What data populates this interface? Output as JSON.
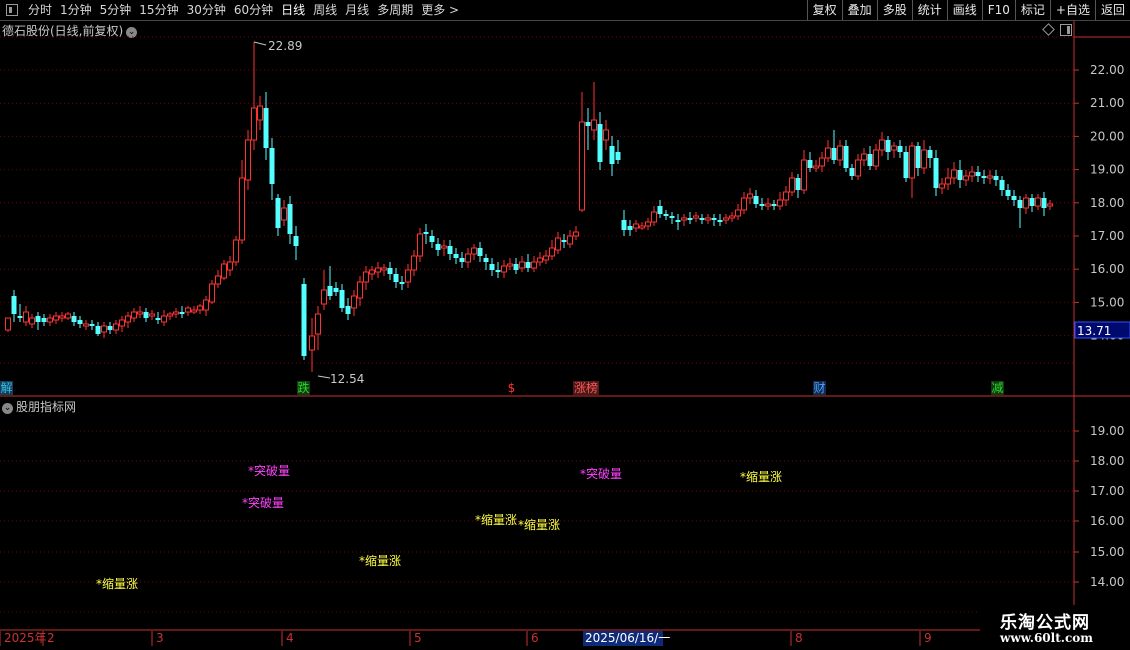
{
  "toolbar": {
    "periods": [
      "分时",
      "1分钟",
      "5分钟",
      "15分钟",
      "30分钟",
      "60分钟",
      "日线",
      "周线",
      "月线",
      "多周期",
      "更多 >"
    ],
    "active_period": "日线",
    "actions": [
      "复权",
      "叠加",
      "多股",
      "统计",
      "画线",
      "F10",
      "标记",
      "+自选",
      "返回"
    ]
  },
  "main_title": "德石股份(日线,前复权)",
  "sub_title": "股朋指标网",
  "price_axis": [
    "22.00",
    "21.00",
    "20.00",
    "19.00",
    "18.00",
    "17.00",
    "16.00",
    "15.00",
    "14.00"
  ],
  "current_price": "13.71",
  "high_label": "22.89",
  "low_label": "12.54",
  "event_tags": [
    {
      "text": "解",
      "color": "#2ec2e8",
      "bg": "#1a3a5a"
    },
    {
      "text": "跌",
      "color": "#22dd22",
      "bg": "#143a14"
    },
    {
      "text": "$",
      "color": "#ff3030",
      "bg": "#000"
    },
    {
      "text": "涨榜",
      "color": "#ff5555",
      "bg": "#4a1a1a"
    },
    {
      "text": "财",
      "color": "#4aa0ff",
      "bg": "#102a50"
    },
    {
      "text": "减",
      "color": "#22dd22",
      "bg": "#143a14"
    }
  ],
  "sub_axis": [
    "19.00",
    "18.00",
    "17.00",
    "16.00",
    "15.00",
    "14.00"
  ],
  "signals": [
    {
      "text": "*突破量",
      "color": "#ff44ff"
    },
    {
      "text": "*突破量",
      "color": "#ff44ff"
    },
    {
      "text": "*突破量",
      "color": "#ff44ff"
    },
    {
      "text": "*缩量涨",
      "color": "#ffff44"
    },
    {
      "text": "*缩量涨",
      "color": "#ffff44"
    },
    {
      "text": "*缩量涨",
      "color": "#ffff44"
    },
    {
      "text": "*缩量涨",
      "color": "#ffff44"
    },
    {
      "text": "*缩量涨",
      "color": "#ffff44"
    }
  ],
  "date_axis": [
    "2025年",
    "2",
    "3",
    "4",
    "5",
    "6",
    "2025/06/16/一",
    "8",
    "9"
  ],
  "watermark": {
    "line1": "乐淘公式网",
    "line2": "www.60lt.com"
  },
  "colors": {
    "up": "#ff3232",
    "down": "#54ffff",
    "grid": "#7a0000",
    "axis": "#c83232"
  }
}
